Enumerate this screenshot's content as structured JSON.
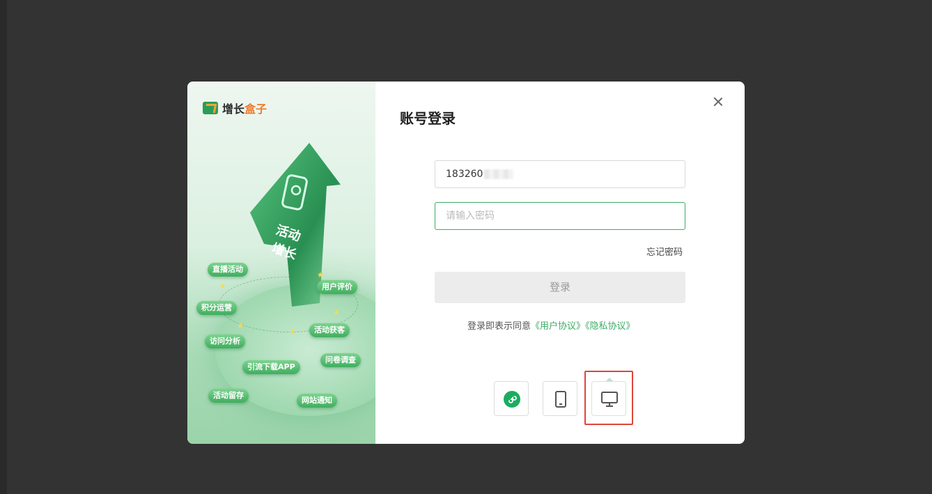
{
  "promo": {
    "logo_text_1": "增长",
    "logo_text_2": "盒子",
    "arrow_text_line1": "活动",
    "arrow_text_line2": "增长",
    "features": [
      "直播活动",
      "用户评价",
      "积分运营",
      "活动获客",
      "访问分析",
      "问卷调查",
      "引流下载APP",
      "活动留存",
      "网站通知"
    ],
    "brand_color": "#3cab66"
  },
  "login": {
    "title": "账号登录",
    "username_value": "183260",
    "password_placeholder": "请输入密码",
    "forgot_label": "忘记密码",
    "login_label": "登录",
    "agree_prefix": "登录即表示同意",
    "user_agreement": "《用户协议》",
    "privacy_agreement": "《隐私协议》"
  },
  "modes": {
    "items": [
      "mini-program-icon",
      "tablet-icon",
      "desktop-icon"
    ],
    "selected": "desktop-icon"
  },
  "colors": {
    "accent": "#3cab66",
    "highlight": "#e0453a",
    "backdrop": "#333333"
  }
}
